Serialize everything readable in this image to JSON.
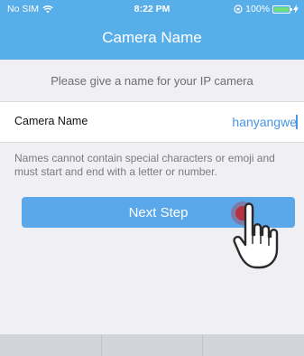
{
  "status_bar": {
    "carrier": "No SIM",
    "time": "8:22 PM",
    "battery": "100%",
    "battery_level": 1.0
  },
  "header": {
    "title": "Camera Name"
  },
  "prompt": {
    "text": "Please give a name for your IP camera"
  },
  "name_field": {
    "label": "Camera Name",
    "value": "hanyangwe"
  },
  "hint": {
    "text": "Names cannot contain special characters or emoji and must start and end with a letter or number."
  },
  "next_button": {
    "label": "Next Step"
  },
  "colors": {
    "header_bg": "#58aee9",
    "button_bg": "#5aa8ea",
    "input_text": "#4a95e0",
    "tap_indicator": "#c0262d"
  }
}
